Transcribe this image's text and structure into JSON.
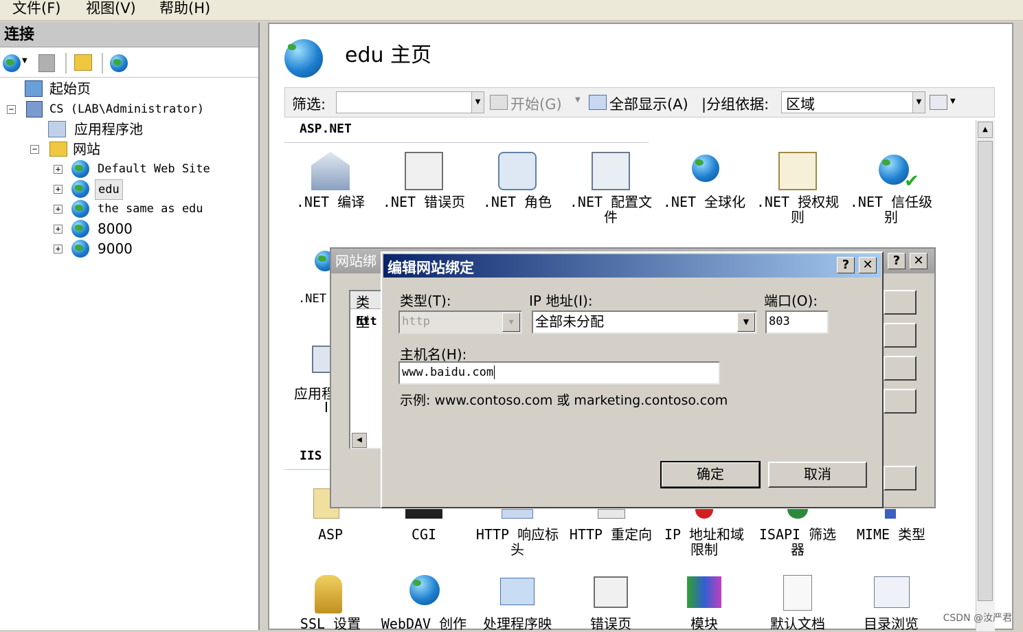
{
  "menubar": {
    "items": [
      {
        "label": "文件(F)"
      },
      {
        "label": "视图(V)"
      },
      {
        "label": "帮助(H)"
      }
    ]
  },
  "connections": {
    "header": "连接",
    "tree": [
      {
        "label": "起始页"
      },
      {
        "label": "CS (LAB\\Administrator)"
      },
      {
        "label": "应用程序池"
      },
      {
        "label": "网站"
      },
      {
        "label": "Default Web Site"
      },
      {
        "label": "edu"
      },
      {
        "label": "the same as edu"
      },
      {
        "label": "8000"
      },
      {
        "label": "9000"
      }
    ]
  },
  "main": {
    "title": "edu 主页",
    "filter": {
      "label": "筛选:",
      "start": "开始(G)",
      "show_all": "全部显示(A)",
      "group_by": "|分组依据:",
      "group_value": "区域"
    },
    "aspnet_section": "ASP.NET",
    "iis_section": "IIS",
    "aspnet_features": [
      {
        "label": ".NET 编译"
      },
      {
        "label": ".NET 错误页"
      },
      {
        "label": ".NET 角色"
      },
      {
        "label": ".NET 配置文件"
      },
      {
        "label": ".NET 全球化"
      },
      {
        "label": ".NET 授权规则"
      },
      {
        "label": ".NET 信任级别"
      }
    ],
    "partial_labels": {
      "net": ".NET",
      "app": "应用程",
      "app2": "I"
    },
    "iis_features": [
      {
        "label": "ASP"
      },
      {
        "label": "CGI"
      },
      {
        "label": "HTTP 响应标头"
      },
      {
        "label": "HTTP 重定向"
      },
      {
        "label": "IP 地址和域限制"
      },
      {
        "label": "ISAPI 筛选器"
      },
      {
        "label": "MIME 类型"
      }
    ],
    "bottom_features": [
      {
        "label": "SSL 设置"
      },
      {
        "label": "WebDAV 创作"
      },
      {
        "label": "处理程序映"
      },
      {
        "label": "错误页"
      },
      {
        "label": "模块"
      },
      {
        "label": "默认文档"
      },
      {
        "label": "目录浏览"
      }
    ]
  },
  "site_bindings_dialog": {
    "title": "网站绑",
    "col_type": "类型",
    "row_type": "htt",
    "help": "?",
    "close": "✕"
  },
  "edit_binding_dialog": {
    "title": "编辑网站绑定",
    "help": "?",
    "close": "✕",
    "type_label": "类型(T):",
    "type_value": "http",
    "ip_label": "IP 地址(I):",
    "ip_value": "全部未分配",
    "port_label": "端口(O):",
    "port_value": "803",
    "host_label": "主机名(H):",
    "host_value": "www.baidu.com",
    "example": "示例: www.contoso.com 或 marketing.contoso.com",
    "ok": "确定",
    "cancel": "取消"
  },
  "watermark": "CSDN @汝严君",
  "colors": {
    "titlebar_start": "#0a246a",
    "titlebar_end": "#a6caf0",
    "dialog_face": "#d4d0c8"
  }
}
